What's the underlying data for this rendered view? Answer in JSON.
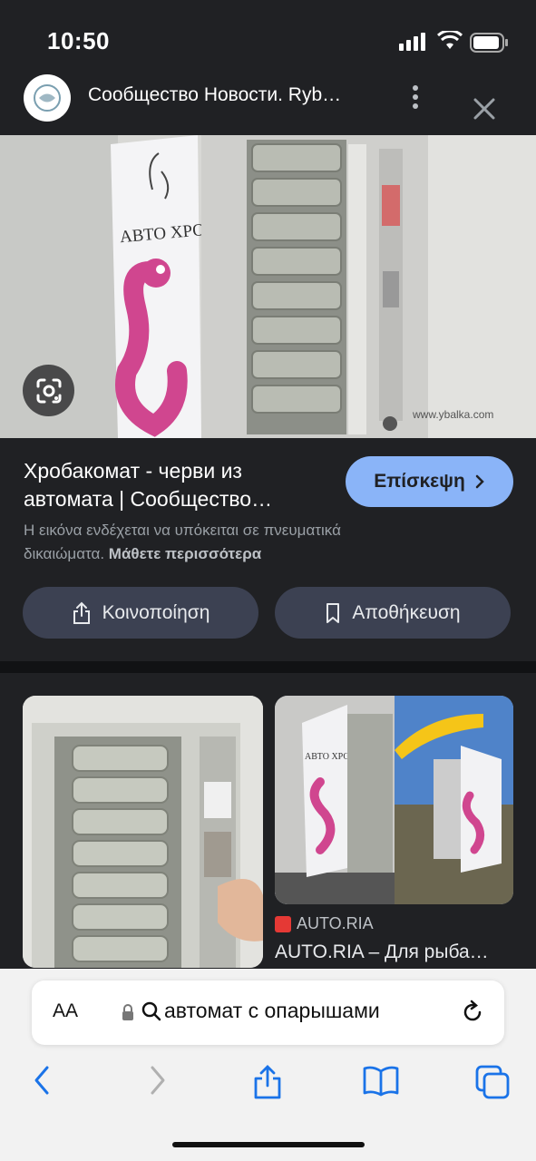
{
  "status_bar": {
    "time": "10:50"
  },
  "header": {
    "site_title": "Сообщество Новости. Ryb…"
  },
  "hero": {
    "sign_text": "АВТО ХРОБ",
    "watermark": "www.ybalka.com"
  },
  "result": {
    "title": "Хробакомат - черви из автомата | Сообщество…",
    "visit_label": "Επίσκεψη",
    "copyright_text": "Η εικόνα ενδέχεται να υπόκειται σε πνευματικά δικαιώματα.",
    "learn_more": "Μάθετε περισσότερα",
    "share_label": "Κοινοποίηση",
    "save_label": "Αποθήκευση"
  },
  "related": [
    {
      "source": "",
      "title": ""
    },
    {
      "source": "AUTO.RIA",
      "title": "AUTO.RIA – Для рыба…",
      "sign_text": "АВТО ХРОБ"
    }
  ],
  "safari": {
    "aa_label": "AA",
    "address": "автомат с опарышами"
  },
  "colors": {
    "background": "#202124",
    "accent": "#8ab4f8",
    "pill": "#3c4152",
    "toolbar": "#f2f2f2",
    "toolbar_icon": "#1a73e8"
  }
}
